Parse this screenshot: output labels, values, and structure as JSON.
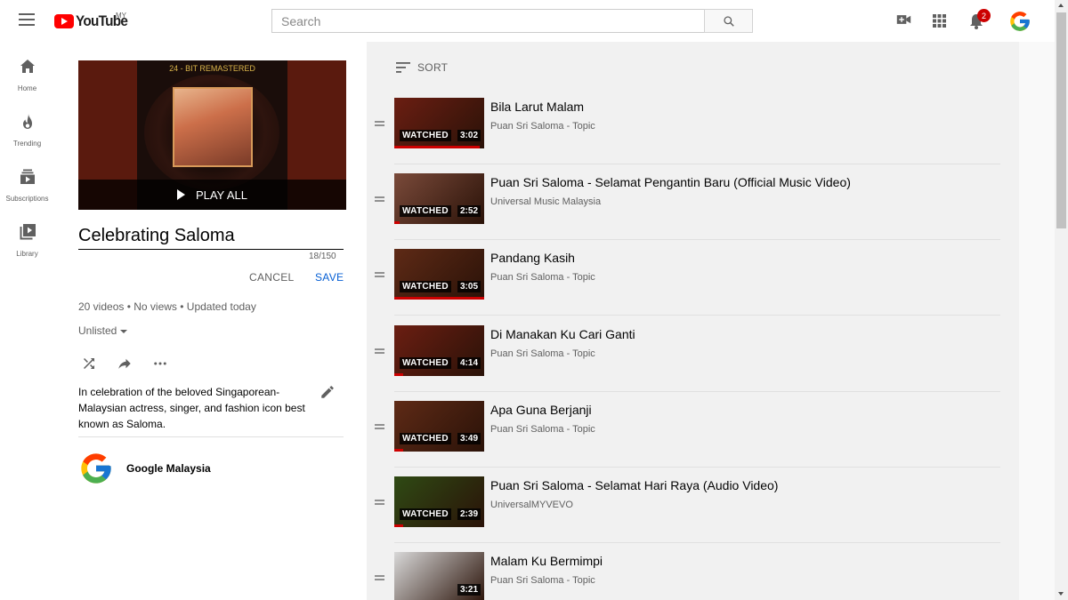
{
  "header": {
    "logo_text": "YouTube",
    "country": "MY",
    "search_placeholder": "Search",
    "notifications_count": "2"
  },
  "nav": {
    "items": [
      {
        "label": "Home"
      },
      {
        "label": "Trending"
      },
      {
        "label": "Subscriptions"
      },
      {
        "label": "Library"
      }
    ]
  },
  "playlist": {
    "cover_banner": "24 - BIT REMASTERED",
    "play_all": "PLAY ALL",
    "title": "Celebrating Saloma",
    "char_count": "18/150",
    "cancel_label": "CANCEL",
    "save_label": "SAVE",
    "stats": "20 videos • No views • Updated today",
    "privacy": "Unlisted",
    "description": "In celebration of the beloved Singaporean-Malaysian actress, singer, and fashion icon best known as Saloma.",
    "owner": "Google Malaysia"
  },
  "list": {
    "sort_label": "SORT",
    "videos": [
      {
        "title": "Bila Larut Malam",
        "channel": "Puan Sri Saloma - Topic",
        "watched": "WATCHED",
        "duration": "3:02",
        "watched_progress": 0.95,
        "thumb": "#6b1e12"
      },
      {
        "title": "Puan Sri Saloma - Selamat Pengantin Baru (Official Music Video)",
        "channel": "Universal Music Malaysia",
        "watched": "WATCHED",
        "duration": "2:52",
        "watched_progress": 0.06,
        "thumb": "#7a4a3a"
      },
      {
        "title": "Pandang Kasih",
        "channel": "Puan Sri Saloma - Topic",
        "watched": "WATCHED",
        "duration": "3:05",
        "watched_progress": 1.0,
        "thumb": "#5e2a16"
      },
      {
        "title": "Di Manakan Ku Cari Ganti",
        "channel": "Puan Sri Saloma - Topic",
        "watched": "WATCHED",
        "duration": "4:14",
        "watched_progress": 0.1,
        "thumb": "#6b1e12"
      },
      {
        "title": "Apa Guna Berjanji",
        "channel": "Puan Sri Saloma - Topic",
        "watched": "WATCHED",
        "duration": "3:49",
        "watched_progress": 0.1,
        "thumb": "#5e2a16"
      },
      {
        "title": "Puan Sri Saloma - Selamat Hari Raya (Audio Video)",
        "channel": "UniversalMYVEVO",
        "watched": "WATCHED",
        "duration": "2:39",
        "watched_progress": 0.1,
        "thumb": "#2f4a14"
      },
      {
        "title": "Malam Ku Bermimpi",
        "channel": "Puan Sri Saloma - Topic",
        "watched": "",
        "duration": "3:21",
        "watched_progress": 0,
        "thumb": "#d8d8d8"
      }
    ]
  },
  "colors": {
    "brand_red": "#ff0000",
    "link_blue": "#065fd4",
    "progress_red": "#cc0000"
  }
}
